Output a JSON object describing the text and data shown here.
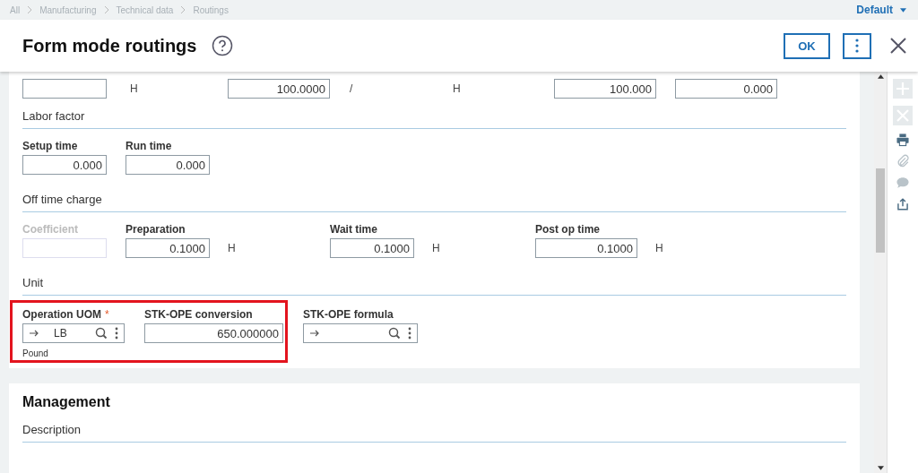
{
  "breadcrumb": [
    {
      "label": "All"
    },
    {
      "label": "Manufacturing"
    },
    {
      "label": "Technical data"
    },
    {
      "label": "Routings"
    }
  ],
  "profile": {
    "label": "Default"
  },
  "title": "Form mode routings",
  "actions": {
    "ok": "OK"
  },
  "toolbar": [
    {
      "kind": "add",
      "disabled": true
    },
    {
      "kind": "delete",
      "disabled": true
    },
    {
      "kind": "print",
      "disabled": false
    },
    {
      "kind": "attach",
      "disabled": true
    },
    {
      "kind": "comment",
      "disabled": true
    },
    {
      "kind": "export",
      "disabled": false
    }
  ],
  "top_row": [
    {
      "kind": "field"
    },
    {
      "kind": "unit",
      "text": "H"
    },
    {
      "kind": "field",
      "value": "100.0000"
    },
    {
      "kind": "unit",
      "text": "/"
    },
    {
      "kind": "unit",
      "text": "H"
    },
    {
      "kind": "field",
      "value": "100.000"
    },
    {
      "kind": "field",
      "value": "0.000"
    }
  ],
  "labor_factor": {
    "title": "Labor factor",
    "fields": [
      {
        "label": "Setup time",
        "value": "0.000"
      },
      {
        "label": "Run time",
        "value": "0.000"
      }
    ]
  },
  "off_time_charge": {
    "title": "Off time charge",
    "fields": [
      {
        "label": "Coefficient",
        "disabled": true
      },
      {
        "label": "Preparation",
        "value": "0.1000",
        "unit": "H",
        "disabled": false
      },
      {
        "label": "Wait time",
        "value": "0.1000",
        "unit": "H",
        "disabled": false
      },
      {
        "label": "Post op time",
        "value": "0.1000",
        "unit": "H",
        "disabled": false
      }
    ]
  },
  "unit": {
    "title": "Unit",
    "fields": [
      {
        "kind": "lookup",
        "label": "Operation UOM",
        "required_mark": "*",
        "value": "LB",
        "description": "Pound",
        "highlighted": true
      },
      {
        "kind": "text",
        "label": "STK-OPE conversion",
        "value": "650.000000",
        "highlighted": true
      },
      {
        "kind": "lookup",
        "label": "STK-OPE formula",
        "highlighted": false
      }
    ]
  },
  "management": {
    "title": "Management",
    "section": "Description"
  }
}
